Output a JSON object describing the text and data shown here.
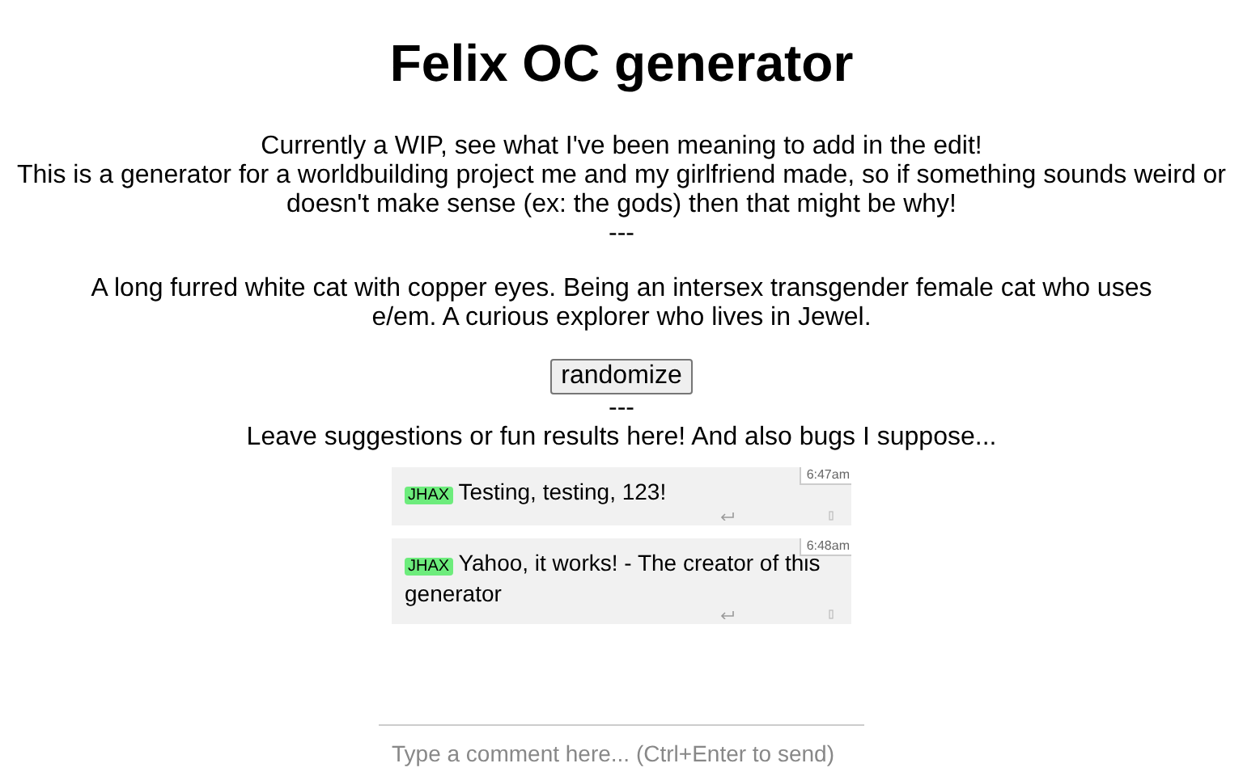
{
  "title": "Felix OC generator",
  "intro": [
    "Currently a WIP, see what I've been meaning to add in the edit!",
    "This is a generator for a worldbuilding project me and my girlfriend made, so if something sounds weird or doesn't make sense (ex: the gods) then that might be why!",
    "---"
  ],
  "result": "A long furred white cat with copper eyes. Being an intersex transgender female cat who uses e/em. A curious explorer who lives in Jewel.",
  "button": "randomize",
  "separator": "---",
  "prompt": "Leave suggestions or fun results here! And also bugs I suppose...",
  "comments": [
    {
      "user": "JHAX",
      "text": "Testing, testing, 123!",
      "time": "6:47am"
    },
    {
      "user": "JHAX",
      "text": "Yahoo, it works! - The creator of this generator",
      "time": "6:48am"
    }
  ],
  "comment_field": {
    "placeholder": "Type a comment here... (Ctrl+Enter to send)"
  }
}
